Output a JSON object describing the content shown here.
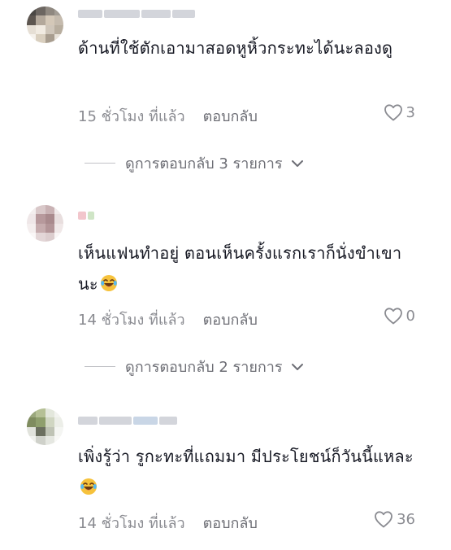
{
  "comments": [
    {
      "text": "ด้านที่ใช้ตักเอามาสอดหูหิ้วกระทะได้นะลองดู",
      "time": "15 ชั่วโมง ที่แล้ว",
      "reply_label": "ตอบกลับ",
      "likes": "3",
      "view_replies": "ดูการตอบกลับ 3 รายการ",
      "has_emoji": false
    },
    {
      "text": "เห็นแฟนทำอยู่ ตอนเห็นครั้งแรกเราก็นั่งขำเขานะ",
      "time": "14 ชั่วโมง ที่แล้ว",
      "reply_label": "ตอบกลับ",
      "likes": "0",
      "view_replies": "ดูการตอบกลับ 2 รายการ",
      "has_emoji": true
    },
    {
      "text": "เพิ่งรู้ว่า รูกะทะที่แถมมา มีประโยชน์ก็วันนี้แหละ",
      "time": "14 ชั่วโมง ที่แล้ว",
      "reply_label": "ตอบกลับ",
      "likes": "36",
      "has_emoji": true
    }
  ],
  "icons": {
    "like": "heart-outline-icon",
    "expand": "chevron-down-icon",
    "emoji": "laughing-tears-emoji"
  },
  "colors": {
    "text": "#161823",
    "meta": "#8a8b91",
    "accent_emoji": "#f6c23c"
  }
}
